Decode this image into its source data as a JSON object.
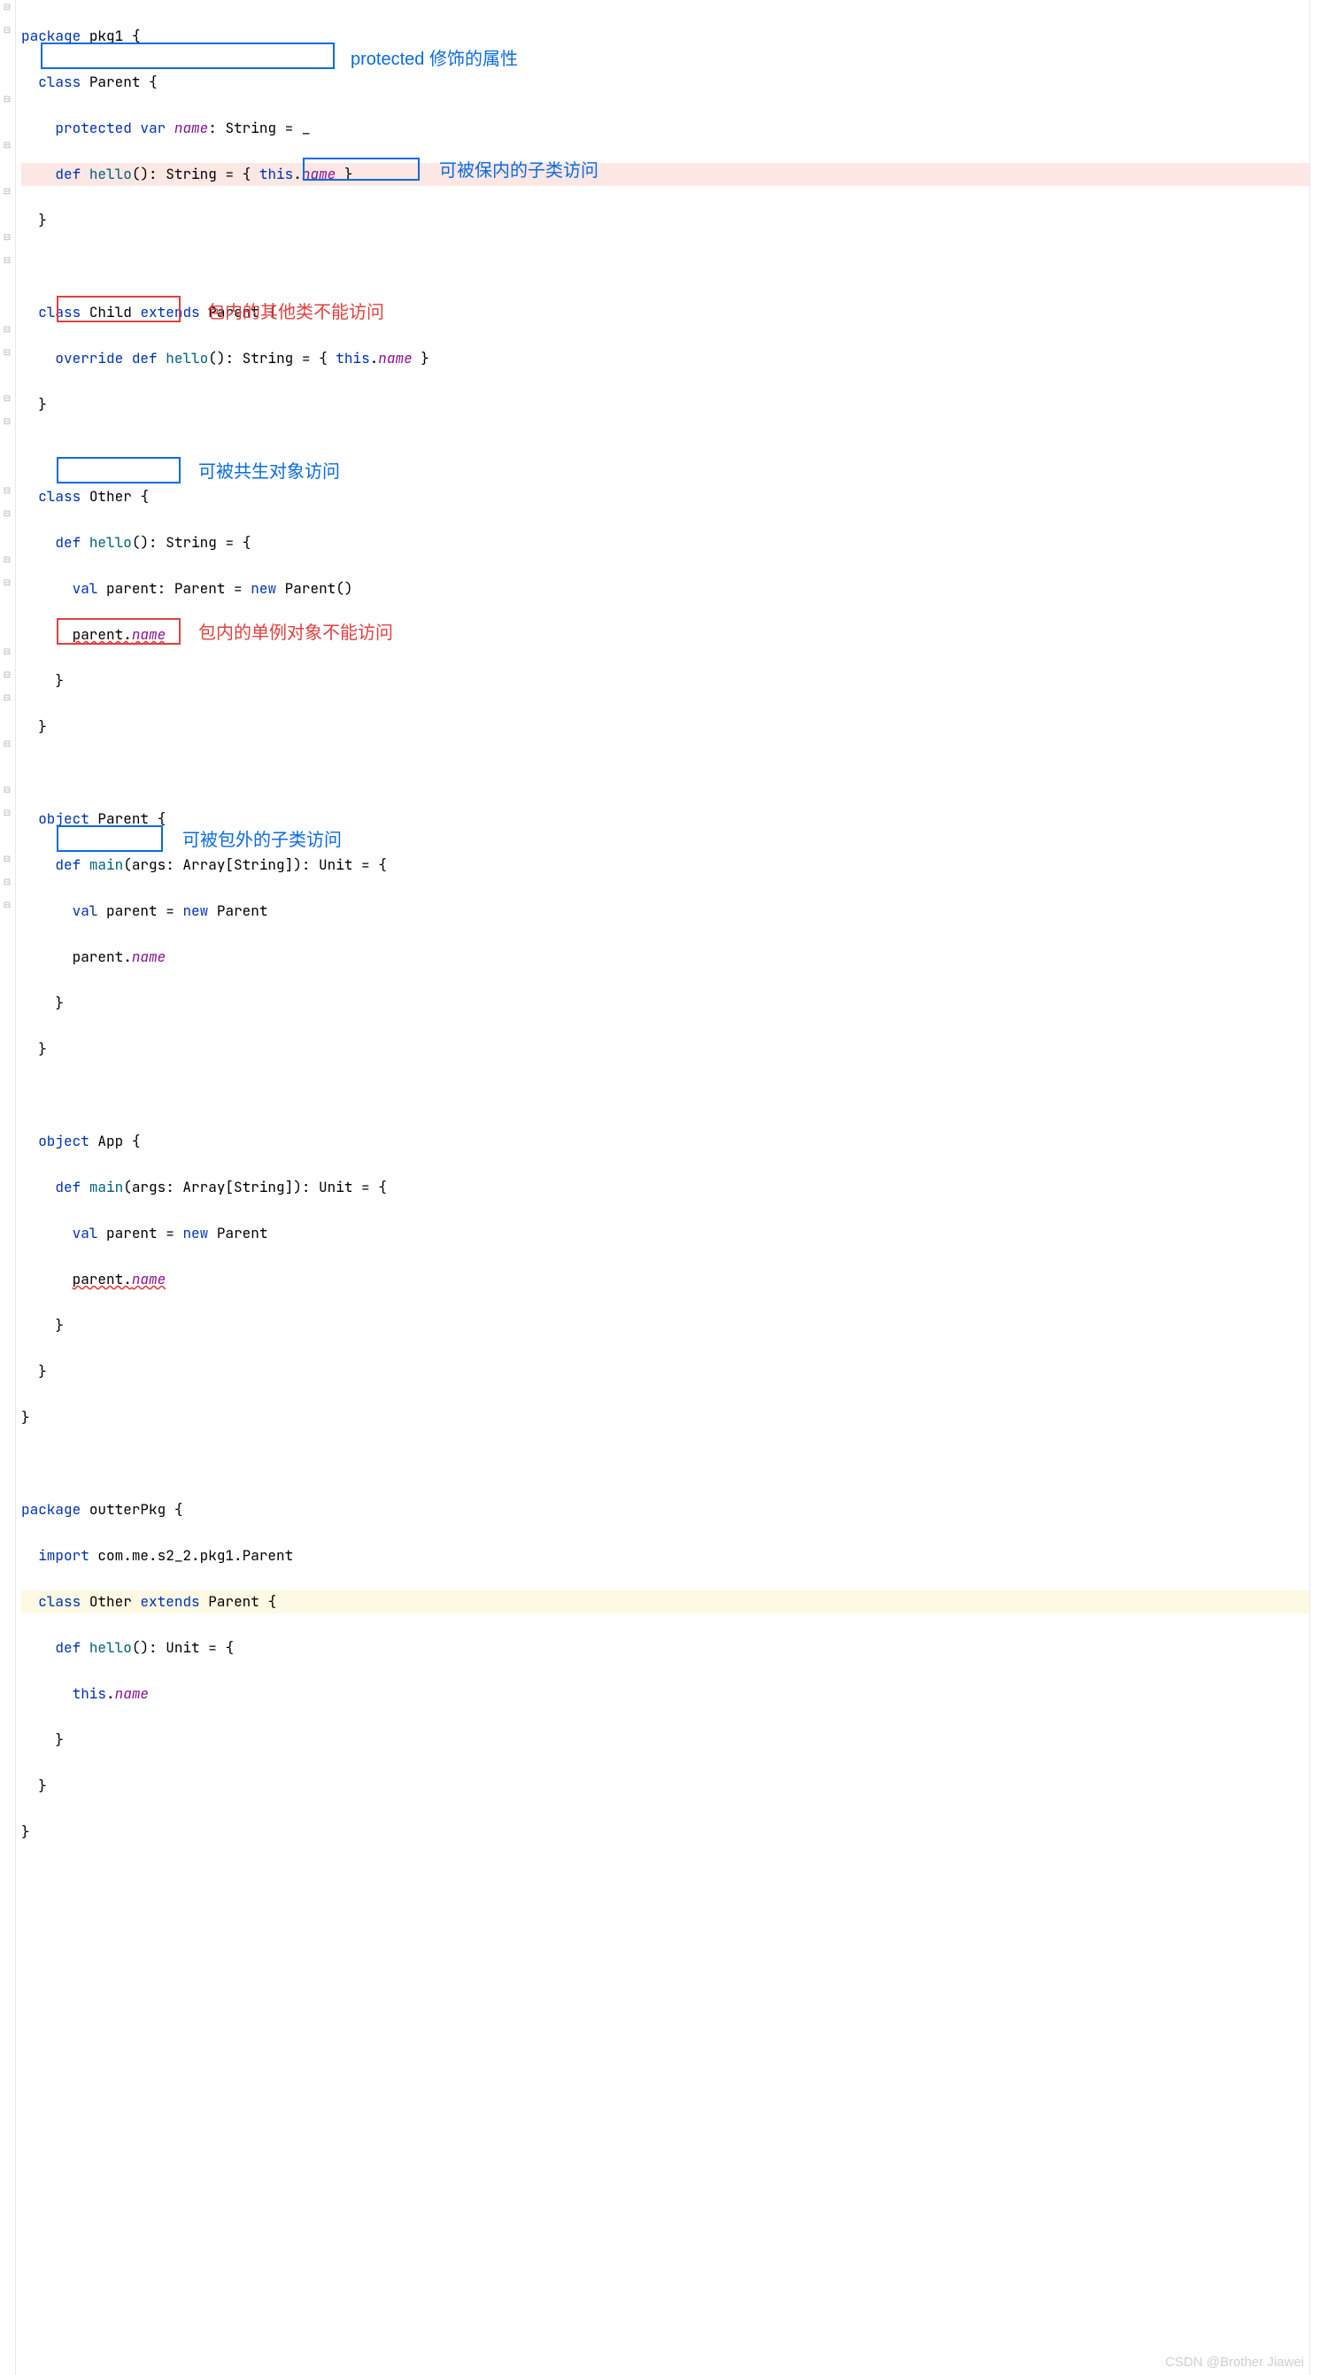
{
  "code": {
    "pkg1": {
      "package_kw": "package",
      "name": "pkg1",
      "open": "{",
      "parent_class": {
        "class_kw": "class",
        "name": "Parent",
        "open": "{",
        "prot": "protected",
        "var": "var",
        "field": "name",
        "colon_type": ": String = _",
        "def": "def",
        "hello": "hello",
        "sig": "(): String = {",
        "this_kw": "this",
        "dot": ".",
        "close_brace": "}",
        "close": "}"
      },
      "child_class": {
        "class_kw": "class",
        "name": "Child",
        "extends": "extends",
        "parent": "Parent",
        "open": "{",
        "override": "override",
        "def": "def",
        "hello": "hello",
        "sig": "(): String = {",
        "this_kw": "this",
        "dot_name": ".",
        "field": "name",
        "close_brace": " }",
        "close": "}"
      },
      "other_class": {
        "class_kw": "class",
        "name": "Other",
        "open": "{",
        "def": "def",
        "hello": "hello",
        "sig": "(): String = {",
        "val": "val",
        "pvar": "parent",
        "colon": ": Parent = ",
        "new": "new",
        "ctor": " Parent()",
        "expr_l": "parent.",
        "expr_r": "name",
        "cb1": "}",
        "cb2": "}"
      },
      "parent_obj": {
        "object": "object",
        "name": "Parent",
        "open": "{",
        "def": "def",
        "main": "main",
        "sig": "(args: Array[String]): Unit = {",
        "val": "val",
        "pvar": "parent",
        "eq": " = ",
        "new": "new",
        "ctor": " Parent",
        "expr_l": "parent.",
        "expr_r": "name",
        "cb1": "}",
        "cb2": "}"
      },
      "app_obj": {
        "object": "object",
        "name": "App",
        "open": "{",
        "def": "def",
        "main": "main",
        "sig": "(args: Array[String]): Unit = {",
        "val": "val",
        "pvar": "parent",
        "eq": " = ",
        "new": "new",
        "ctor": " Parent",
        "expr_l": "parent.",
        "expr_r": "name",
        "cb1": "}",
        "cb2": "}"
      },
      "close": "}"
    },
    "outter": {
      "package_kw": "package",
      "name": "outterPkg",
      "open": "{",
      "import": "import",
      "path": "com.me.s2_2.pkg1.Parent",
      "class_kw": "class",
      "cls": "Other",
      "extends": "extends",
      "parent": "Parent",
      "copen": "{",
      "def": "def",
      "hello": "hello",
      "sig": "(): Unit = {",
      "this": "this",
      "dot": ".",
      "field": "name",
      "cb1": "}",
      "cb2": "}",
      "close": "}"
    }
  },
  "annotations": {
    "a1": "protected 修饰的属性",
    "a2": "可被保内的子类访问",
    "a3": "包内的其他类不能访问",
    "a4": "可被共生对象访问",
    "a5": "包内的单例对象不能访问",
    "a6": "可被包外的子类访问"
  },
  "watermark": "CSDN @Brother Jiawei"
}
